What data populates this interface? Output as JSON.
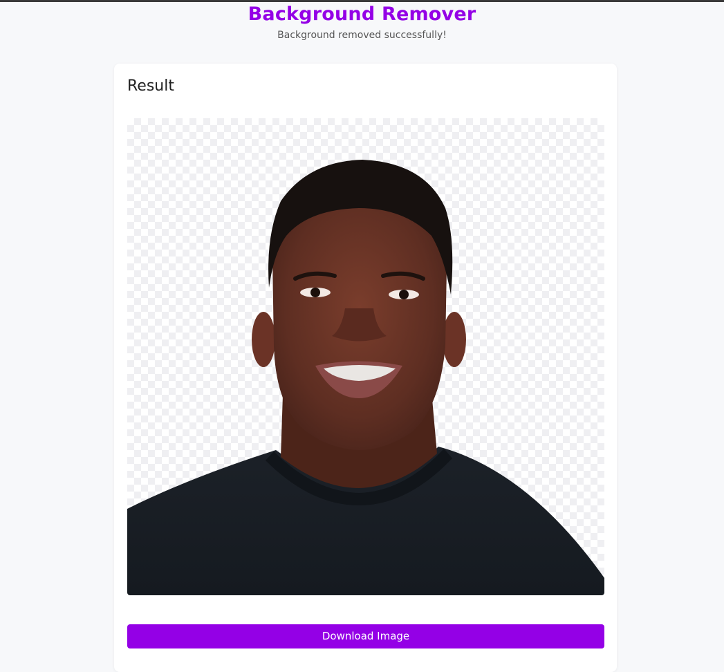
{
  "header": {
    "title": "Background Remover",
    "status": "Background removed successfully!"
  },
  "result": {
    "heading": "Result",
    "image_alt": "portrait-with-background-removed",
    "download_label": "Download Image"
  },
  "colors": {
    "accent": "#9400e6",
    "page_background": "#f7f8fa",
    "card_background": "#ffffff"
  }
}
